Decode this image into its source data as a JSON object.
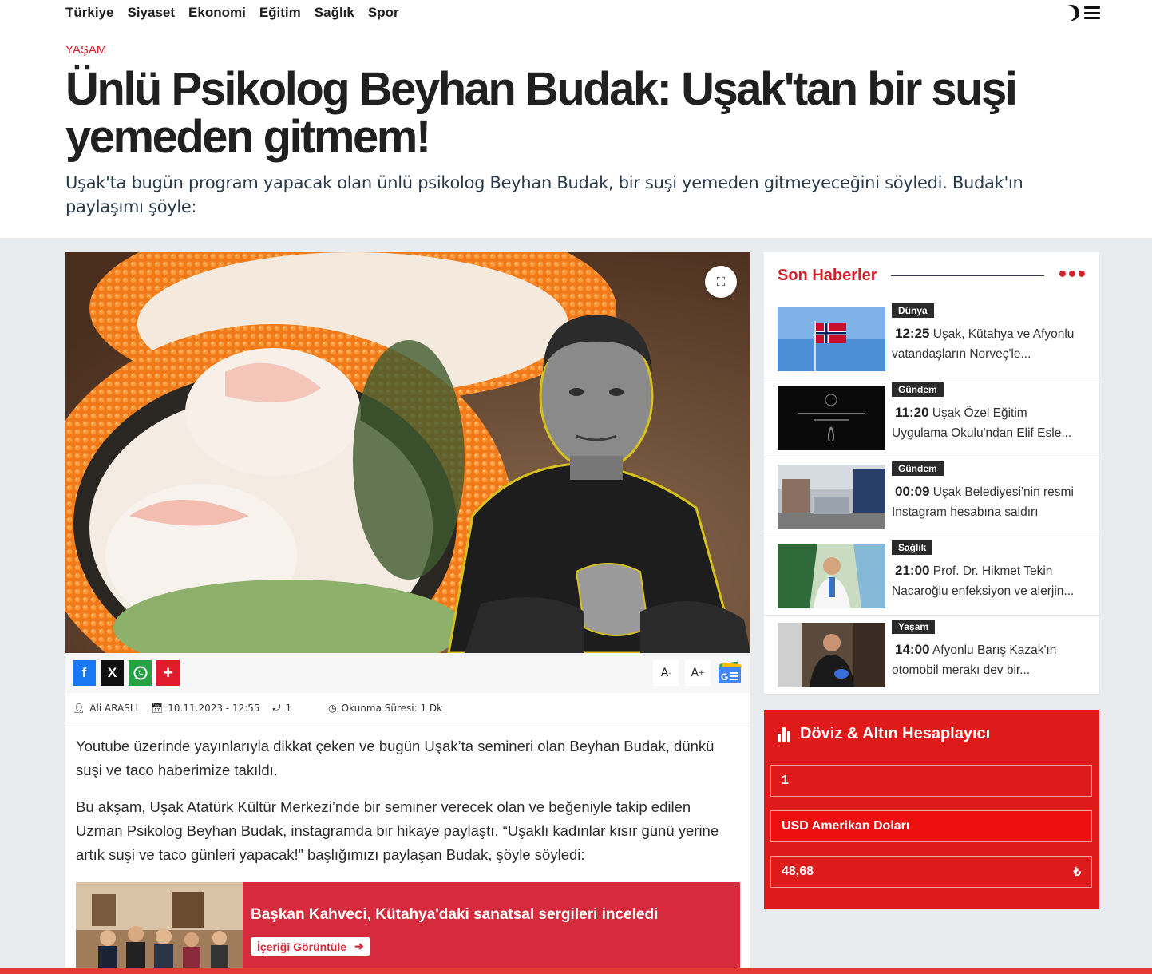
{
  "nav": {
    "items": [
      "Türkiye",
      "Siyaset",
      "Ekonomi",
      "Eğitim",
      "Sağlık",
      "Spor"
    ],
    "icons": [
      "moon-icon",
      "hamburger-menu-icon"
    ]
  },
  "article": {
    "category": "YAŞAM",
    "title": "Ünlü Psikolog Beyhan Budak: Uşak'tan bir suşi yemeden gitmem!",
    "summary": "Uşak'ta bugün program yapacak olan ünlü psikolog Beyhan Budak, bir suşi yemeden gitmeyeceğini söyledi. Budak'ın paylaşımı şöyle:",
    "share": {
      "facebook": "f",
      "x": "X",
      "plus": "+",
      "font_decrease": "A",
      "font_increase": "A"
    },
    "meta": {
      "author": "Ali ARASLI",
      "date": "10.11.2023 - 12:55",
      "share_count": "1",
      "reading_time": "Okunma Süresi: 1 Dk"
    },
    "paragraphs": [
      "Youtube üzerinde yayınlarıyla dikkat çeken ve bugün Uşak’ta semineri olan Beyhan Budak, dünkü suşi ve taco haberimize takıldı.",
      "Bu akşam, Uşak Atatürk Kültür Merkezi’nde bir seminer verecek olan ve beğeniyle takip edilen Uzman Psikolog Beyhan Budak, instagramda bir hikaye paylaştı. “Uşaklı kadınlar kısır günü yerine artık suşi ve taco günleri yapacak!” başlığımızı paylaşan Budak, şöyle söyledi:"
    ],
    "related": {
      "title": "Başkan Kahveci, Kütahya'daki sanatsal sergileri inceledi",
      "button": "İçeriği Görüntüle"
    }
  },
  "sidebar": {
    "title": "Son Haberler",
    "items": [
      {
        "category": "Dünya",
        "time": "12:25",
        "text1": "Uşak, Kütahya ve Afyonlu",
        "text2": "vatandaşların Norveç'le..."
      },
      {
        "category": "Gündem",
        "time": "11:20",
        "text1": "Uşak Özel Eğitim",
        "text2": "Uygulama Okulu'ndan Elif Esle..."
      },
      {
        "category": "Gündem",
        "time": "00:09",
        "text1": "Uşak Belediyesi'nin resmi",
        "text2": "Instagram hesabına saldırı"
      },
      {
        "category": "Sağlık",
        "time": "21:00",
        "text1": "Prof. Dr. Hikmet Tekin",
        "text2": "Nacaroğlu enfeksiyon ve alerjin..."
      },
      {
        "category": "Yaşam",
        "time": "14:00",
        "text1": "Afyonlu Barış Kazak'ın",
        "text2": "otomobil merakı dev bir..."
      }
    ]
  },
  "currency": {
    "title": "Döviz & Altın Hesaplayıcı",
    "amount": "1",
    "selected_currency": "USD Amerikan Doları",
    "result": "48,68",
    "symbol": "₺"
  },
  "colors": {
    "accent": "#d3202a",
    "currency_bg": "#de1a1a",
    "related_bg": "#d52b3c"
  }
}
